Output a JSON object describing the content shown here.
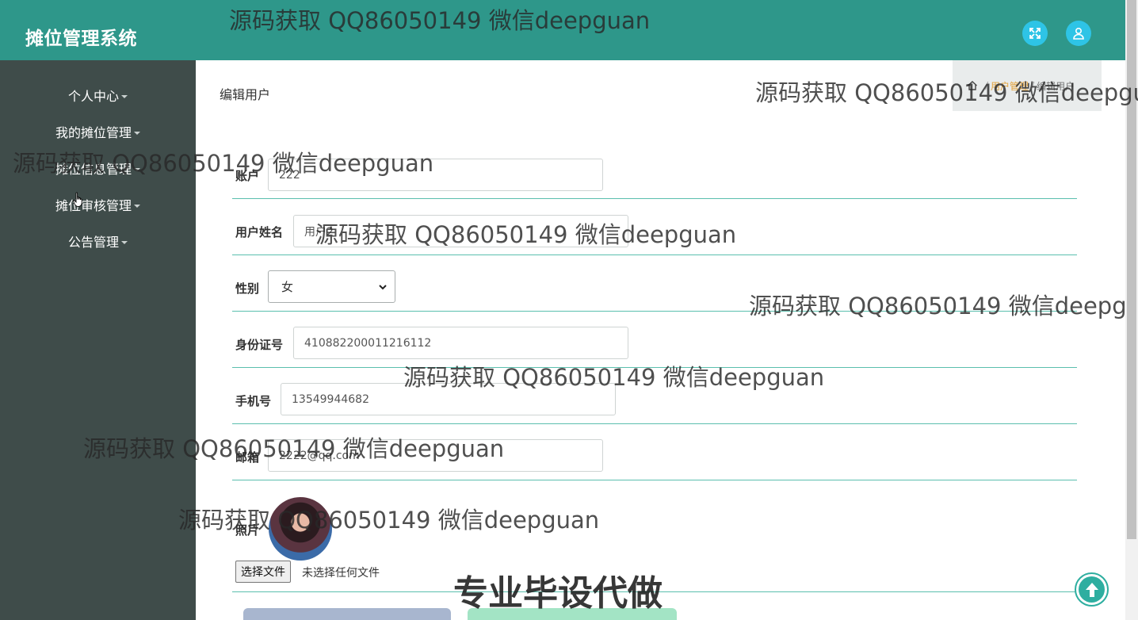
{
  "header": {
    "title": "摊位管理系统"
  },
  "sidebar": {
    "items": [
      {
        "label": "个人中心"
      },
      {
        "label": "我的摊位管理"
      },
      {
        "label": "摊位信息管理"
      },
      {
        "label": "摊位审核管理"
      },
      {
        "label": "公告管理"
      }
    ]
  },
  "main": {
    "page_title": "编辑用户",
    "breadcrumb": {
      "current": "用户管理",
      "page": "编辑用户"
    }
  },
  "form": {
    "account": {
      "label": "账户",
      "value": "222"
    },
    "name": {
      "label": "用户姓名",
      "value": "用户2"
    },
    "gender": {
      "label": "性别",
      "value": "女"
    },
    "id_card": {
      "label": "身份证号",
      "value": "410882200011216112"
    },
    "phone": {
      "label": "手机号",
      "value": "13549944682"
    },
    "email": {
      "label": "邮箱",
      "value": "2222@qq.com"
    },
    "photo": {
      "label": "照片",
      "file_button": "选择文件",
      "file_status": "未选择任何文件"
    }
  },
  "watermarks": {
    "text": "源码获取 QQ86050149 微信deepguan",
    "banner": "专业毕设代做"
  },
  "colors": {
    "header": "#2e978a",
    "sidebar": "#3f4c4a",
    "accent": "#2ec4e6",
    "divider": "#5bbfae"
  }
}
